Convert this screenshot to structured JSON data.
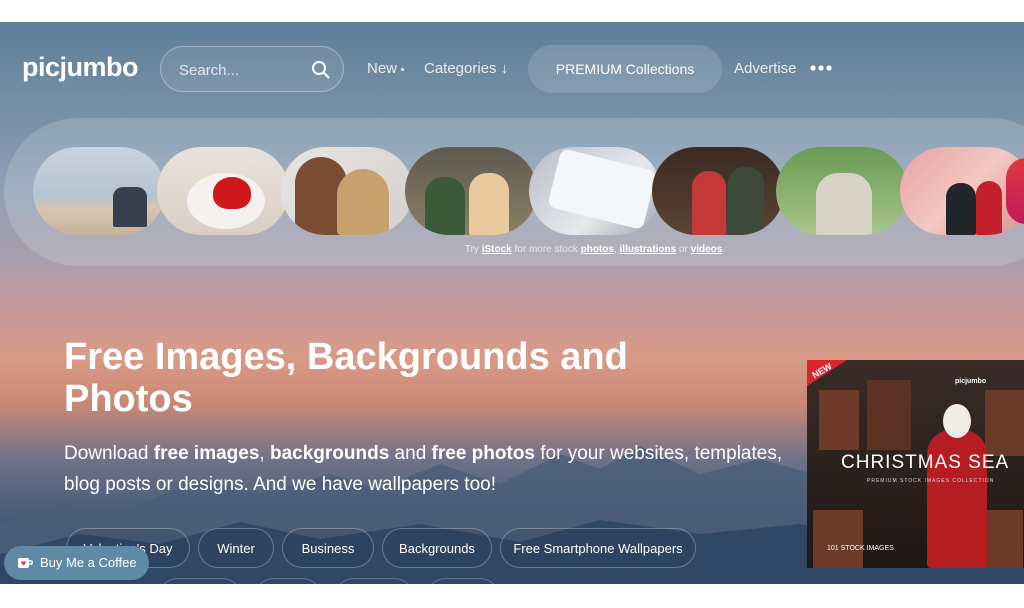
{
  "header": {
    "logo": "picjumbo",
    "search_placeholder": "Search...",
    "nav": {
      "new": "New",
      "categories": "Categories ↓",
      "premium": "PREMIUM Collections",
      "advertise": "Advertise"
    }
  },
  "strip": {
    "credit_prefix": "Try ",
    "credit_istock": "iStock",
    "credit_mid": " for more stock ",
    "credit_photos": "photos",
    "credit_sep": ", ",
    "credit_illustrations": "illustrations",
    "credit_or": " or ",
    "credit_videos": "videos",
    "credit_end": "."
  },
  "hero": {
    "title": "Free Images, Backgrounds and Photos",
    "desc_1": "Download ",
    "desc_b1": "free images",
    "desc_2": ", ",
    "desc_b2": "backgrounds",
    "desc_3": " and ",
    "desc_b3": "free photos",
    "desc_4": " for your websites, templates, blog posts or designs. And we have wallpapers too!"
  },
  "chips": [
    "Valentine's Day",
    "Winter",
    "Business",
    "Backgrounds",
    "Free Smartphone Wallpapers"
  ],
  "promo": {
    "badge": "NEW",
    "logo": "picjumbo",
    "title": "CHRISTMAS SEA",
    "subtitle": "PREMIUM STOCK IMAGES COLLECTION",
    "count": "101 STOCK IMAGES"
  },
  "bmc": {
    "label": "Buy Me a Coffee"
  },
  "colors": {
    "accent": "#5e8aa6",
    "badge": "#d9252e"
  }
}
